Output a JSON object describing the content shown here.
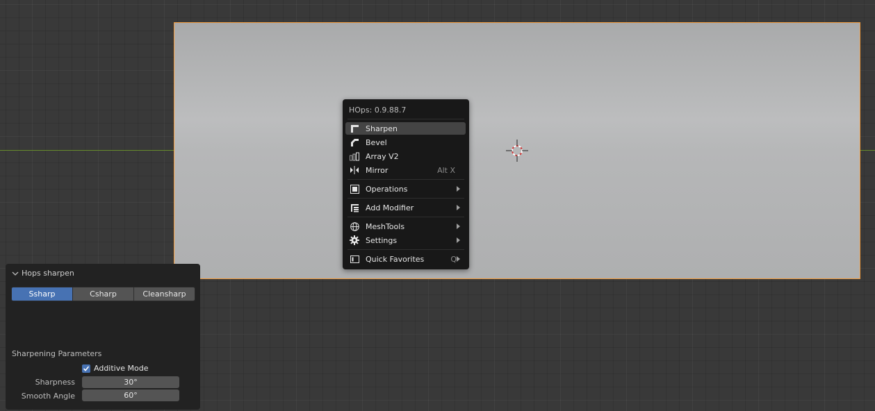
{
  "viewport": {
    "accent_color": "#f39b3b",
    "axis_color": "#6a8f2d"
  },
  "menu": {
    "title": "HOps: 0.9.88.7",
    "items": [
      {
        "label": "Sharpen",
        "icon": "sharpen-icon",
        "shortcut": "",
        "submenu": false,
        "active": true
      },
      {
        "label": "Bevel",
        "icon": "bevel-icon",
        "shortcut": "",
        "submenu": false,
        "active": false
      },
      {
        "label": "Array V2",
        "icon": "array-icon",
        "shortcut": "",
        "submenu": false,
        "active": false
      },
      {
        "label": "Mirror",
        "icon": "mirror-icon",
        "shortcut": "Alt X",
        "submenu": false,
        "active": false
      },
      {
        "label": "Operations",
        "icon": "operations-icon",
        "shortcut": "",
        "submenu": true,
        "active": false
      },
      {
        "label": "Add Modifier",
        "icon": "modifier-icon",
        "shortcut": "",
        "submenu": true,
        "active": false
      },
      {
        "label": "MeshTools",
        "icon": "globe-icon",
        "shortcut": "",
        "submenu": true,
        "active": false
      },
      {
        "label": "Settings",
        "icon": "gear-icon",
        "shortcut": "",
        "submenu": true,
        "active": false
      },
      {
        "label": "Quick Favorites",
        "icon": "favorites-icon",
        "shortcut": "Q",
        "submenu": true,
        "active": false
      }
    ]
  },
  "panel": {
    "title": "Hops sharpen",
    "modes": [
      "Ssharp",
      "Csharp",
      "Cleansharp"
    ],
    "selected_mode": "Ssharp",
    "section": "Sharpening Parameters",
    "additive_label": "Additive Mode",
    "additive_checked": true,
    "sharpness_label": "Sharpness",
    "sharpness_value": "30°",
    "smooth_label": "Smooth Angle",
    "smooth_value": "60°",
    "accent_color": "#4772b3"
  }
}
